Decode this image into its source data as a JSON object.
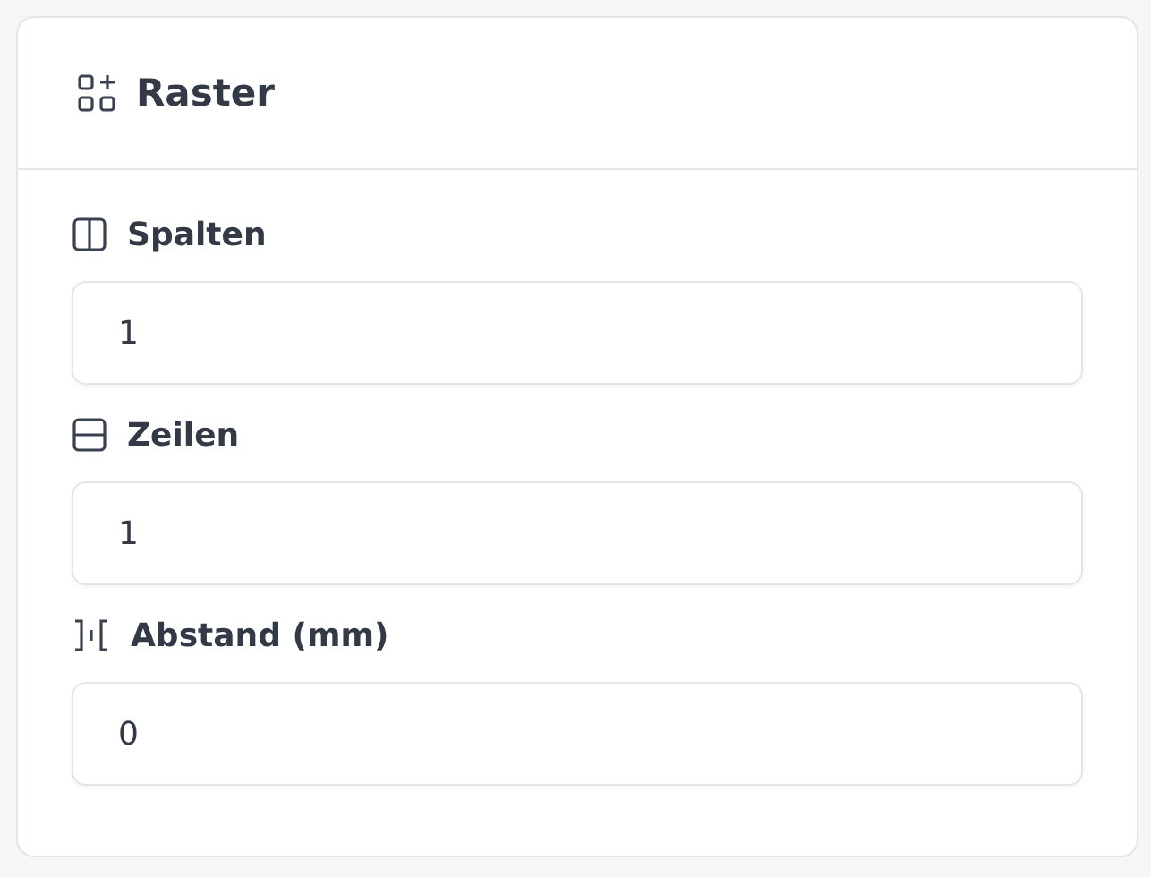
{
  "card": {
    "title": "Raster"
  },
  "fields": [
    {
      "kind": "columns",
      "label": "Spalten",
      "value": "1"
    },
    {
      "kind": "rows",
      "label": "Zeilen",
      "value": "1"
    },
    {
      "kind": "gap",
      "label": "Abstand (mm)",
      "value": "0"
    }
  ]
}
